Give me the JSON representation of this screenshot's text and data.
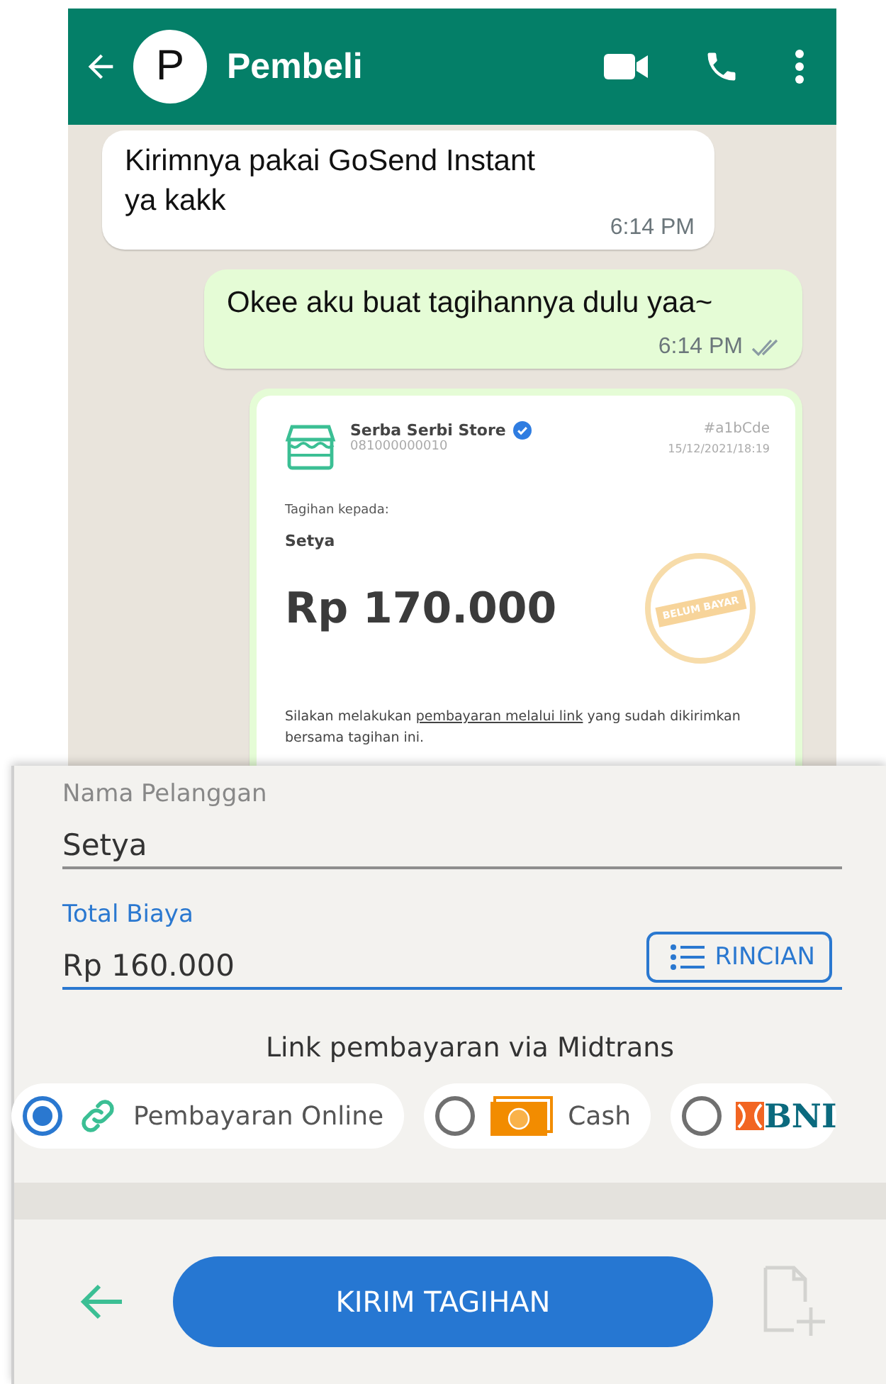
{
  "chat": {
    "contact": "Pembeli",
    "avatar_letter": "P"
  },
  "messages": [
    {
      "kind": "incoming",
      "text": "Kirimnya pakai GoSend Instant ya kakk",
      "time": "6:14 PM"
    },
    {
      "kind": "outgoing",
      "text": "Okee aku buat tagihannya dulu yaa~",
      "time": "6:14 PM",
      "read": true
    },
    {
      "kind": "invoice",
      "store": "Serba Serbi Store",
      "verified": true,
      "phone": "081000000010",
      "code": "#a1bCde",
      "date": "15/12/2021/18:19",
      "to_label": "Tagihan kepada:",
      "customer": "Setya",
      "amount": "Rp 170.000",
      "stamp": "BELUM BAYAR",
      "note_before": "Silakan melakukan ",
      "note_link": "pembayaran melalui link",
      "note_after": " yang sudah dikirimkan bersama tagihan ini."
    }
  ],
  "form": {
    "name_label": "Nama Pelanggan",
    "name_value": "Setya",
    "total_label": "Total Biaya",
    "total_value": "Rp 160.000",
    "details_button": "RINCIAN",
    "payment_title": "Link pembayaran via Midtrans"
  },
  "payment_options": [
    {
      "kind": "link",
      "label": "Pembayaran Online",
      "selected": true
    },
    {
      "kind": "cash",
      "label": "Cash",
      "selected": false
    },
    {
      "kind": "bank",
      "label": "BNI",
      "selected": false
    }
  ],
  "submit_button": "KIRIM TAGIHAN"
}
